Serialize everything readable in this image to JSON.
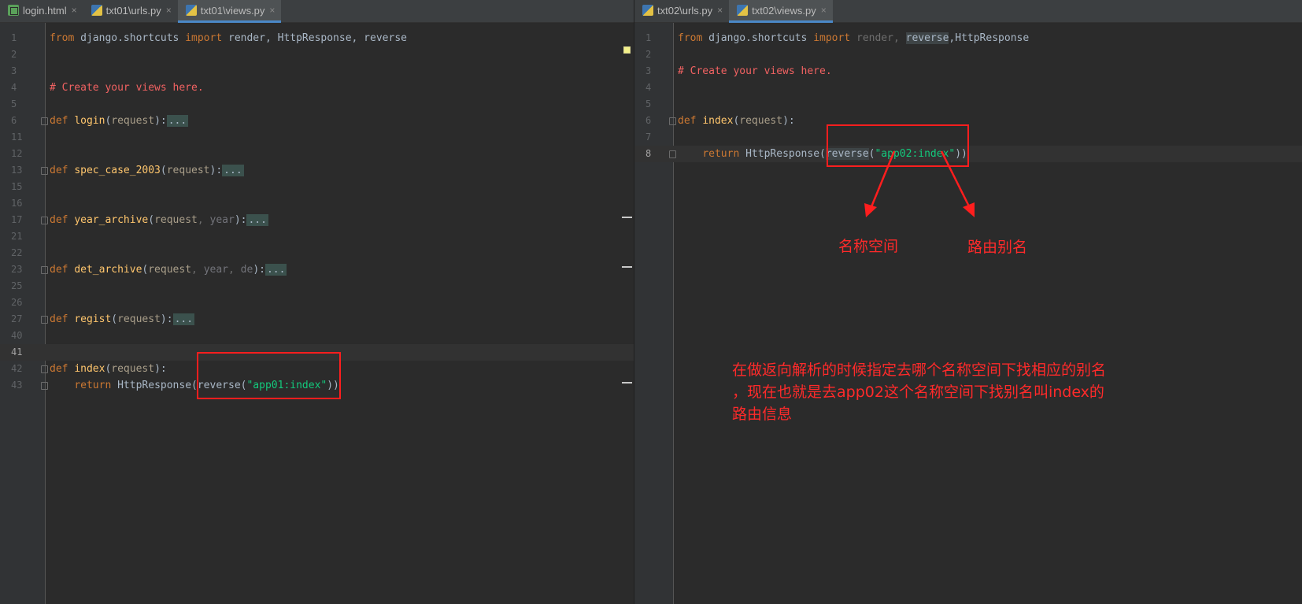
{
  "left_pane": {
    "tabs": [
      {
        "label": "login.html",
        "icon": "html-file-icon",
        "active": false
      },
      {
        "label": "txt01\\urls.py",
        "icon": "python-file-icon",
        "active": false
      },
      {
        "label": "txt01\\views.py",
        "icon": "python-file-icon",
        "active": true
      }
    ],
    "close_glyph": "×",
    "lines": {
      "l1": "1",
      "l2": "2",
      "l3": "3",
      "l4": "4",
      "l5": "5",
      "l6": "6",
      "l11": "11",
      "l12": "12",
      "l13": "13",
      "l15": "15",
      "l16": "16",
      "l17": "17",
      "l21": "21",
      "l22": "22",
      "l23": "23",
      "l25": "25",
      "l26": "26",
      "l27": "27",
      "l40": "40",
      "l41": "41",
      "l42": "42",
      "l43": "43"
    },
    "code": {
      "from": "from",
      "module": " django.shortcuts ",
      "import": "import",
      "imports": " render, HttpResponse, reverse",
      "comment": "# Create your views here.",
      "def": "def",
      "f_login": "login",
      "f_spec": "spec_case_2003",
      "f_year": "year_archive",
      "f_det": "det_archive",
      "f_regist": "regist",
      "f_index": "index",
      "p_request": "request",
      "p_year": "year",
      "p_de": "de",
      "open": "(",
      "close": "):",
      "comma": ", ",
      "dots": "...",
      "return": "return",
      "http": " HttpResponse(",
      "reverse": "reverse(",
      "arg": "\"app01:index\"",
      "end": "))"
    }
  },
  "right_pane": {
    "tabs": [
      {
        "label": "txt02\\urls.py",
        "icon": "python-file-icon",
        "active": false
      },
      {
        "label": "txt02\\views.py",
        "icon": "python-file-icon",
        "active": true
      }
    ],
    "close_glyph": "×",
    "lines": {
      "l1": "1",
      "l2": "2",
      "l3": "3",
      "l4": "4",
      "l5": "5",
      "l6": "6",
      "l7": "7",
      "l8": "8"
    },
    "code": {
      "from": "from",
      "module": " django.shortcuts ",
      "import": "import",
      "render": " render, ",
      "reverse_imp": "reverse",
      "comma": ",",
      "http_imp": "HttpResponse",
      "comment": "# Create your views here.",
      "def": "def",
      "f_index": "index",
      "open": "(",
      "p_request": "request",
      "close": "):",
      "return": "return",
      "http": " HttpResponse(",
      "reverse": "reverse",
      "paren": "(",
      "arg": "\"app02:index\"",
      "end": "))"
    }
  },
  "annotations": {
    "namespace_label": "名称空间",
    "route_alias_label": "路由别名",
    "explanation": "在做返向解析的时候指定去哪个名称空间下找相应的别名\n，现在也就是去app02这个名称空间下找别名叫index的\n路由信息",
    "color": "#ff1e1e"
  },
  "theme": {
    "editor_bg": "#2b2b2b",
    "keyword": "#cc7832",
    "function": "#ffc66d",
    "string": "#13c97c",
    "comment": "#f16262"
  }
}
